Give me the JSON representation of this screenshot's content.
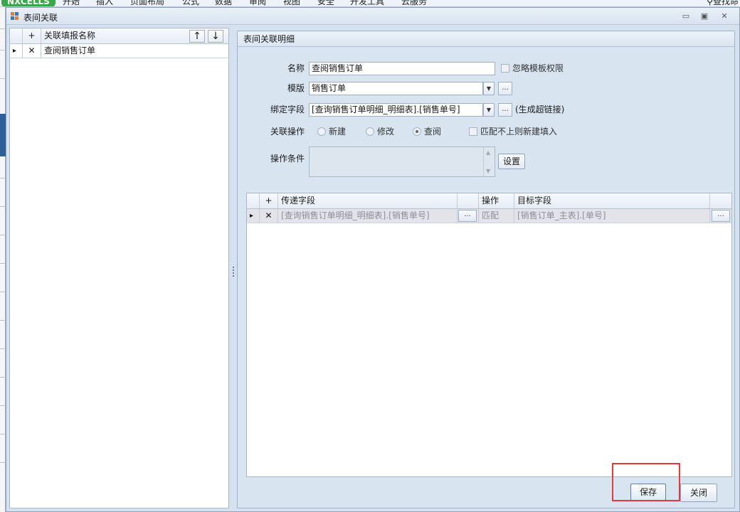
{
  "ribbon": {
    "brand": "NXCELLS",
    "tabs": [
      "开始",
      "插入",
      "页面布局",
      "公式",
      "数据",
      "审阅",
      "视图",
      "安全",
      "开发工具",
      "云服务"
    ],
    "search": "查找命"
  },
  "window": {
    "title": "表间关联",
    "controls": {
      "minimize": "▭",
      "maximize": "▣",
      "close": "✕"
    }
  },
  "left_grid": {
    "add_symbol": "+",
    "column_header": "关联填报名称",
    "up_symbol": "↑",
    "down_symbol": "↓",
    "rows": [
      {
        "indicator": "▸",
        "delete_symbol": "✕",
        "name": "查阅销售订单"
      }
    ]
  },
  "detail": {
    "group_caption": "表间关联明细",
    "name_label": "名称",
    "name_value": "查阅销售订单",
    "ignore_perm_label": "忽略模板权限",
    "template_label": "模版",
    "template_value": "销售订单",
    "ellipsis": "...",
    "bind_label": "绑定字段",
    "bind_value": "[查询销售订单明细_明细表].[销售单号]",
    "bind_hint": "(生成超链接)",
    "op_label": "关联操作",
    "op_options": [
      "新建",
      "修改",
      "查阅"
    ],
    "op_selected": "查阅",
    "match_new_label": "匹配不上则新建填入",
    "cond_label": "操作条件",
    "settings_button": "设置"
  },
  "detail_grid": {
    "add_symbol": "+",
    "headers": {
      "source": "传递字段",
      "op": "操作",
      "target": "目标字段"
    },
    "rows": [
      {
        "indicator": "▸",
        "delete_symbol": "✕",
        "source": "[查询销售订单明细_明细表].[销售单号]",
        "op": "匹配",
        "target": "[销售订单_主表].[单号]"
      }
    ]
  },
  "footer": {
    "save_button": "保存",
    "close_button": "关闭"
  },
  "colors": {
    "highlight": "#e23b3b",
    "brand": "#3aa84a"
  }
}
